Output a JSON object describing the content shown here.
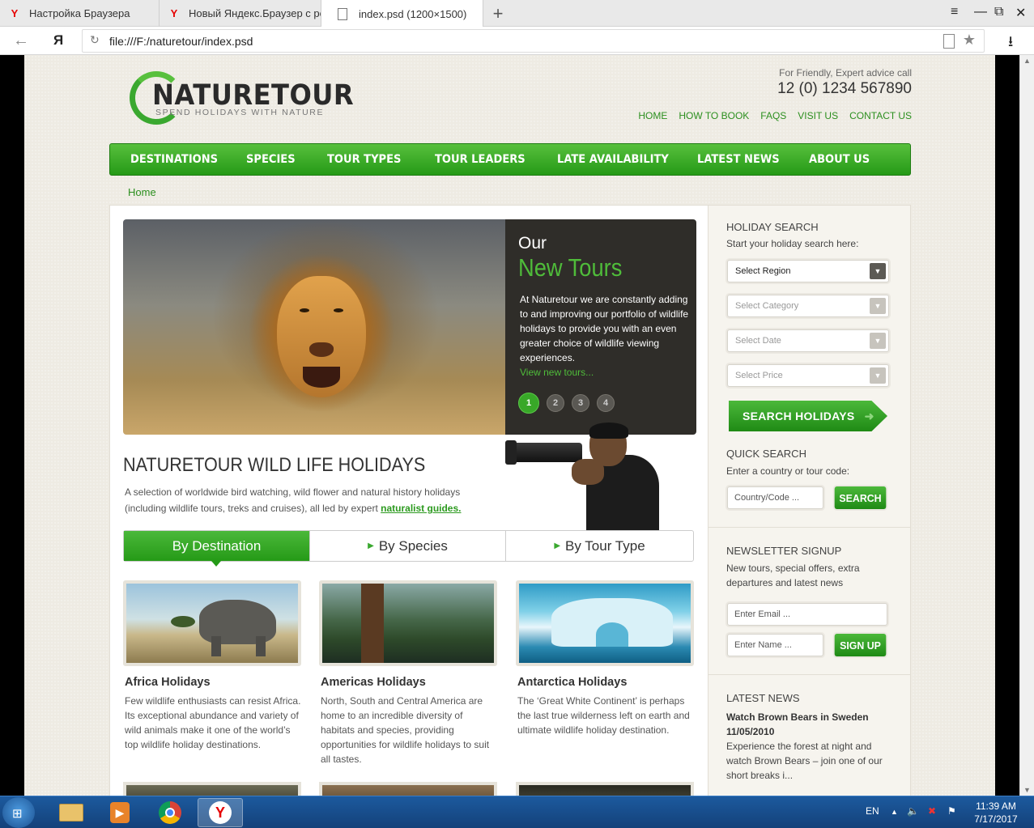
{
  "browser": {
    "tabs": [
      {
        "title": "Настройка Браузера",
        "icon": "yandex-icon"
      },
      {
        "title": "Новый Яндекс.Браузер с ре",
        "icon": "yandex-icon"
      },
      {
        "title": "index.psd (1200×1500)",
        "icon": "document-icon"
      }
    ],
    "new_tab": "+",
    "back": "←",
    "yandex_button": "Я",
    "reload": "↻",
    "url": "file:///F:/naturetour/index.psd",
    "bookmark": "★",
    "download": "⭳",
    "window_controls": {
      "menu": "≡",
      "minimize": "—",
      "restore": "⧉",
      "close": "✕"
    }
  },
  "header": {
    "logo_title": "NATURETOUR",
    "logo_tagline": "SPEND HOLIDAYS WITH NATURE",
    "call_label": "For Friendly, Expert advice call",
    "call_number": "12 (0) 1234 567890",
    "top_links": [
      "HOME",
      "HOW TO BOOK",
      "FAQS",
      "VISIT US",
      "CONTACT US"
    ]
  },
  "main_nav": [
    "DESTINATIONS",
    "SPECIES",
    "TOUR TYPES",
    "TOUR LEADERS",
    "LATE AVAILABILITY",
    "LATEST NEWS",
    "ABOUT US"
  ],
  "breadcrumb": "Home",
  "hero": {
    "kicker": "Our",
    "title": "New Tours",
    "text": "At Naturetour we are constantly adding to and improving our portfolio of wildlife holidays to provide you with an even greater choice of wildlife viewing experiences.",
    "link": "View new tours...",
    "dots": [
      "1",
      "2",
      "3",
      "4"
    ]
  },
  "intro": {
    "title": "NATURETOUR  WILD LIFE HOLIDAYS",
    "desc": "A selection of worldwide bird watching, wild flower and natural history holidays (including wildlife tours, treks and cruises), all led by expert ",
    "desc_link": "naturalist guides."
  },
  "content_tabs": [
    "By Destination",
    "By Species",
    "By Tour Type"
  ],
  "cards": [
    {
      "title": "Africa Holidays",
      "text": "Few wildlife enthusiasts can resist Africa. Its exceptional abundance and variety of wild animals make it one of the world’s top wildlife holiday destinations."
    },
    {
      "title": "Americas Holidays",
      "text": "North, South and Central America are home to an incredible diversity of habitats and species, providing opportunities for wildlife holidays to suit all tastes."
    },
    {
      "title": "Antarctica Holidays",
      "text": "The ‘Great White Continent’ is perhaps the last true wilderness left on earth and ultimate wildlife holiday destination."
    }
  ],
  "sidebar": {
    "holiday_search": {
      "heading": "HOLIDAY SEARCH",
      "intro": "Start your holiday search here:",
      "selects": [
        "Select Region",
        "Select Category",
        "Select Date",
        "Select Price"
      ],
      "button": "SEARCH HOLIDAYS"
    },
    "quick_search": {
      "heading": "QUICK SEARCH",
      "intro": "Enter a country or tour code:",
      "placeholder": "Country/Code ...",
      "button": "SEARCH"
    },
    "newsletter": {
      "heading": "NEWSLETTER SIGNUP",
      "intro": "New tours, special offers, extra departures and latest news",
      "email_placeholder": "Enter Email ...",
      "name_placeholder": "Enter Name ...",
      "button": "SIGN UP"
    },
    "latest_news": {
      "heading": "LATEST NEWS",
      "title": "Watch Brown Bears in Sweden",
      "date": "11/05/2010",
      "text": "Experience the forest at night and watch Brown Bears – join one of our short breaks i..."
    }
  },
  "taskbar": {
    "language": "EN",
    "time": "11:39 AM",
    "date": "7/17/2017"
  },
  "colors": {
    "brand_green": "#3aa82f",
    "nav_green": "#259a17",
    "dark_panel": "#2f2d29"
  }
}
